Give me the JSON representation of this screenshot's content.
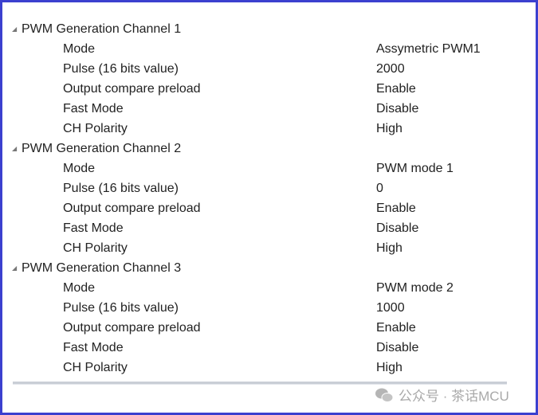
{
  "groups": [
    {
      "title": "PWM Generation Channel 1",
      "props": [
        {
          "label": "Mode",
          "value": "Assymetric PWM1"
        },
        {
          "label": "Pulse (16 bits value)",
          "value": "2000"
        },
        {
          "label": "Output compare preload",
          "value": "Enable"
        },
        {
          "label": "Fast Mode",
          "value": "Disable"
        },
        {
          "label": "CH Polarity",
          "value": "High"
        }
      ]
    },
    {
      "title": "PWM Generation Channel 2",
      "props": [
        {
          "label": "Mode",
          "value": "PWM mode 1"
        },
        {
          "label": "Pulse (16 bits value)",
          "value": "0"
        },
        {
          "label": "Output compare preload",
          "value": "Enable"
        },
        {
          "label": "Fast Mode",
          "value": "Disable"
        },
        {
          "label": "CH Polarity",
          "value": "High"
        }
      ]
    },
    {
      "title": "PWM Generation Channel 3",
      "props": [
        {
          "label": "Mode",
          "value": "PWM mode 2"
        },
        {
          "label": "Pulse (16 bits value)",
          "value": "1000"
        },
        {
          "label": "Output compare preload",
          "value": "Enable"
        },
        {
          "label": "Fast Mode",
          "value": "Disable"
        },
        {
          "label": "CH Polarity",
          "value": "High"
        }
      ]
    }
  ],
  "watermark": "公众号 · 茶话MCU",
  "colors": {
    "border": "#3b40cf",
    "text": "#222222"
  }
}
